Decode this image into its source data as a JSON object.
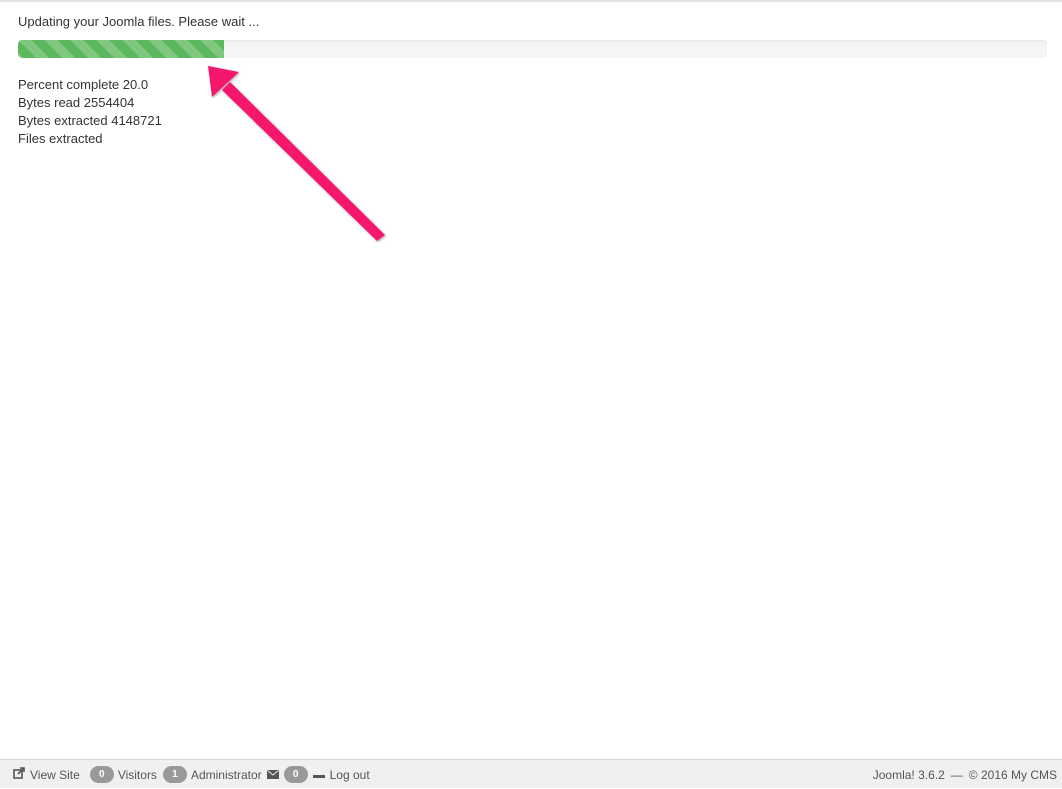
{
  "status_text": "Updating your Joomla files. Please wait ...",
  "progress": {
    "percent": 20.0,
    "color": "#5cb85c"
  },
  "stats": {
    "percent_line": "Percent complete 20.0",
    "bytes_read_line": "Bytes read 2554404",
    "bytes_extracted_line": "Bytes extracted 4148721",
    "files_extracted_line": "Files extracted"
  },
  "annotation": {
    "arrow_color": "#f5146e"
  },
  "footer": {
    "view_site_label": "View Site",
    "visitors_count": "0",
    "visitors_label": "Visitors",
    "admins_count": "1",
    "admins_label": "Administrator",
    "messages_count": "0",
    "logout_label": "Log out",
    "version_text": "Joomla! 3.6.2",
    "separator": "—",
    "copyright_text": "© 2016 My CMS"
  }
}
